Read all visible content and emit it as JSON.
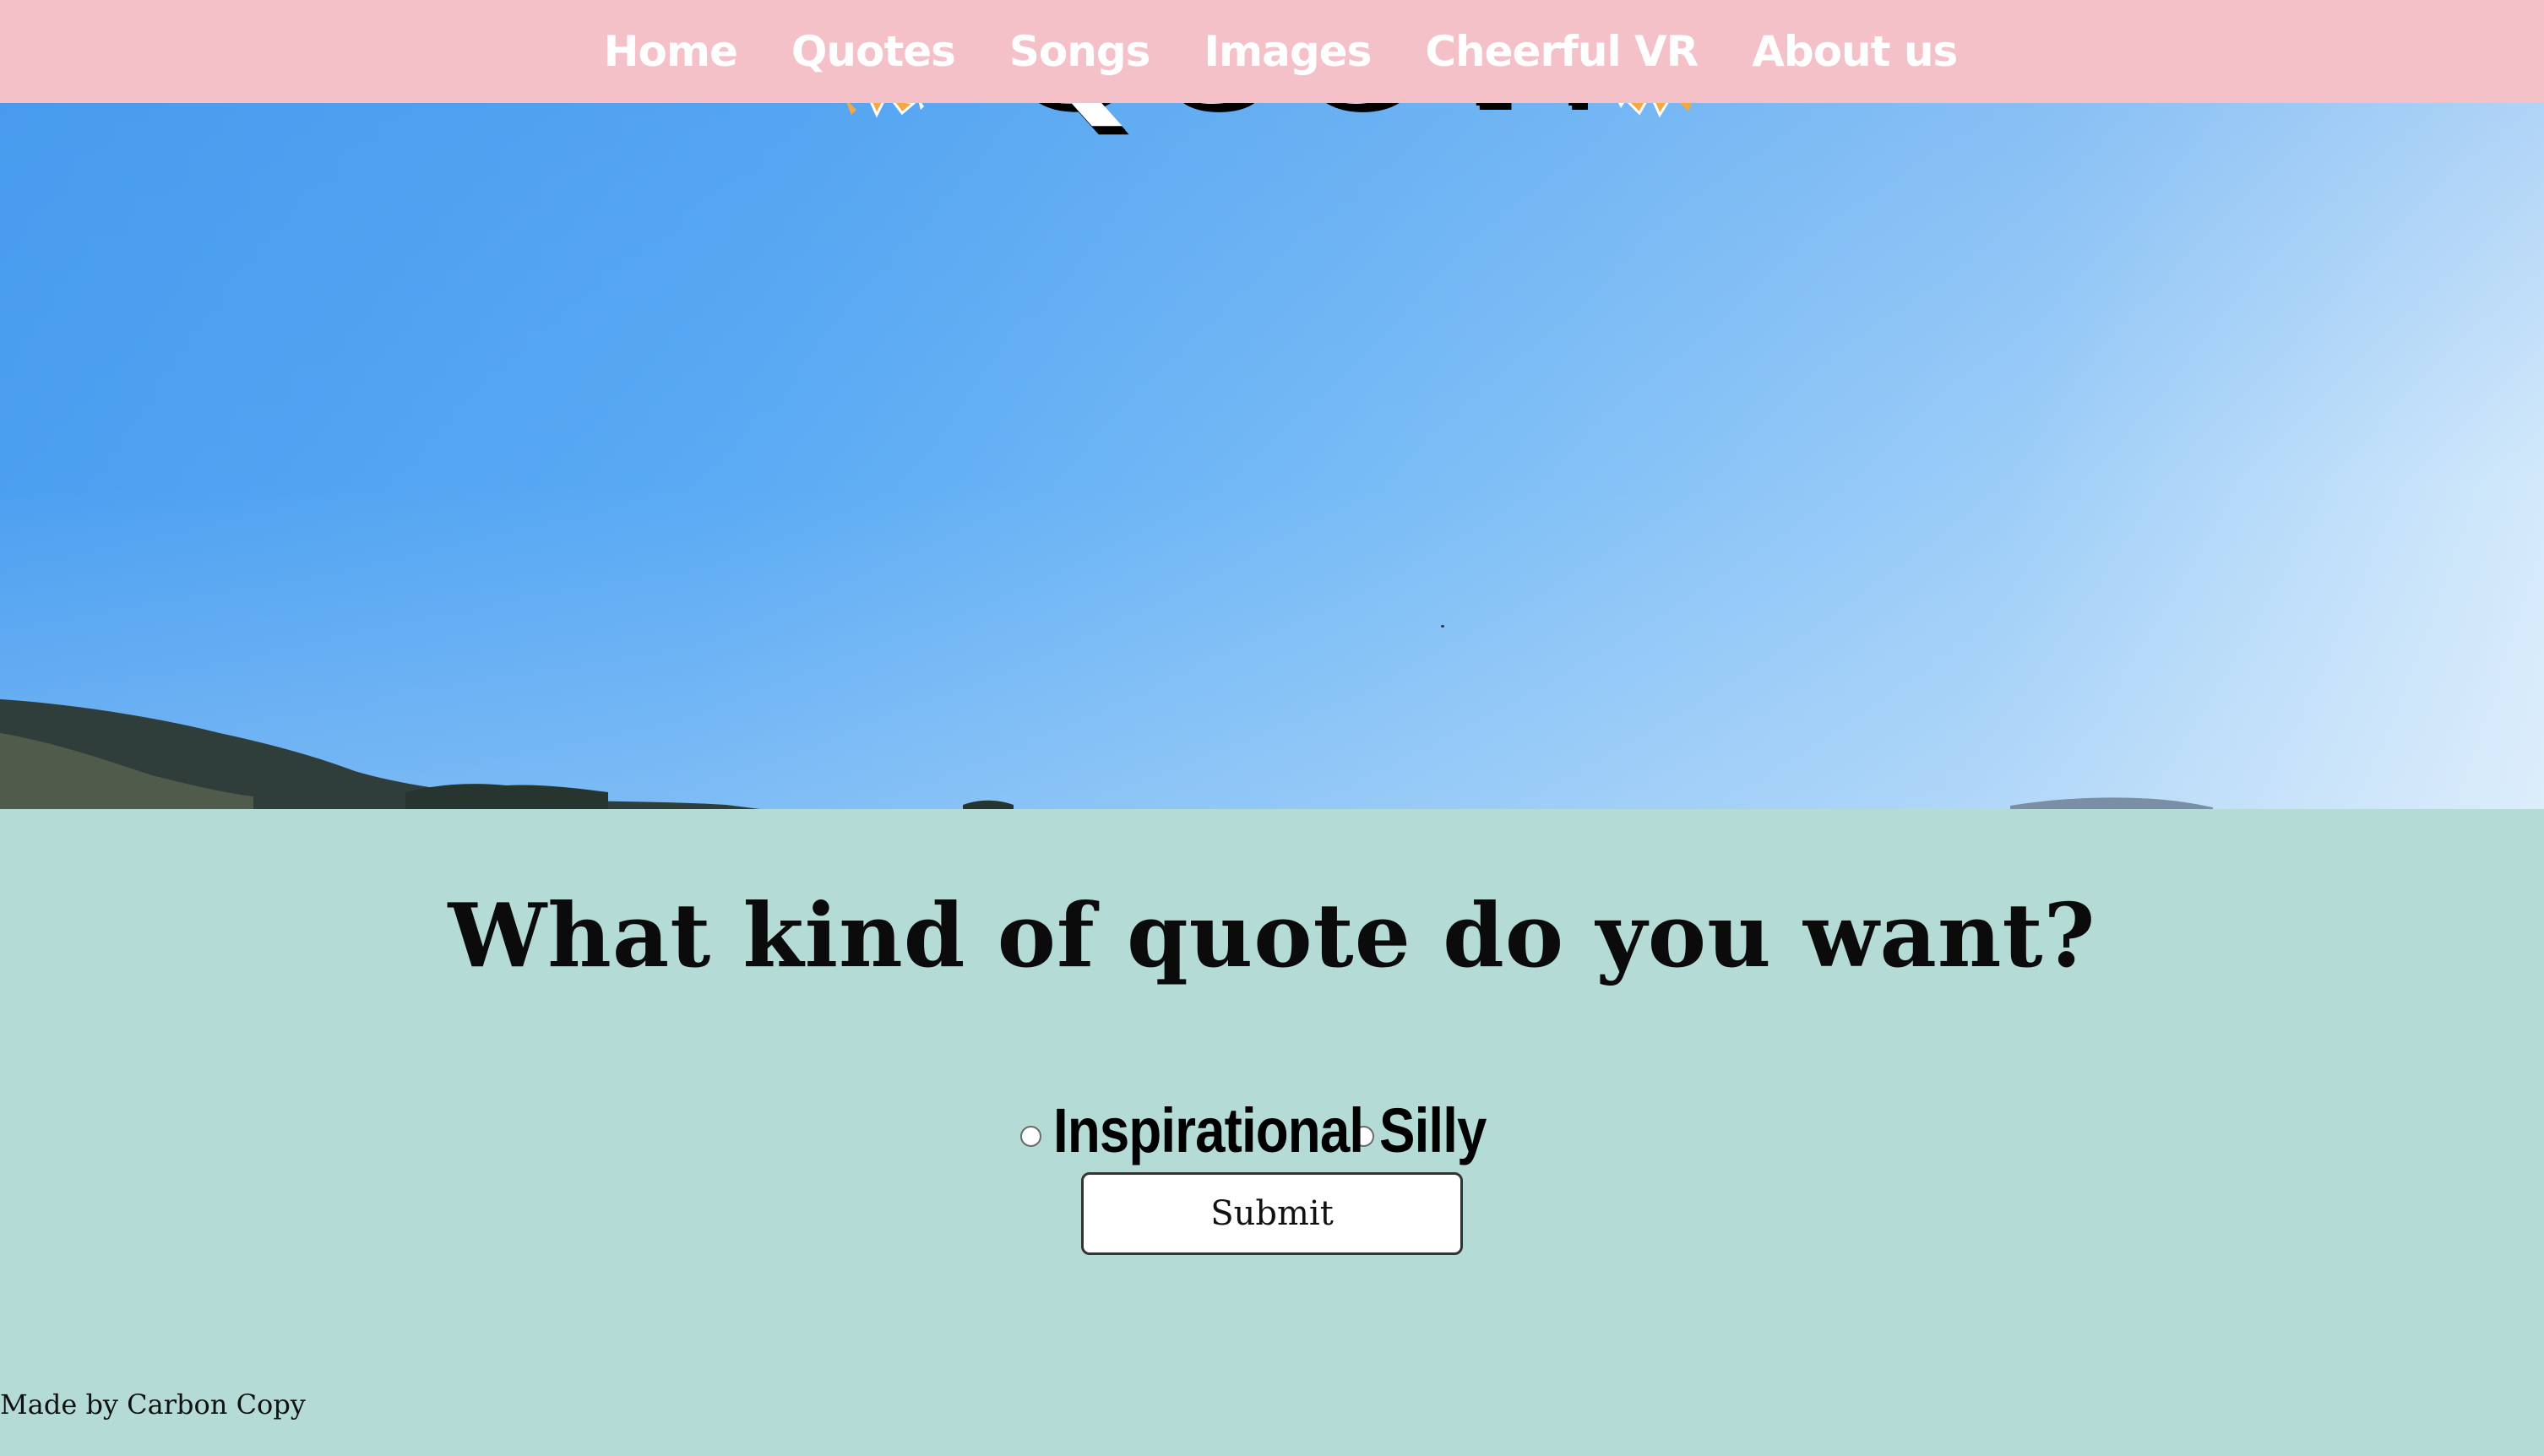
{
  "nav": {
    "items": [
      {
        "label": "Home"
      },
      {
        "label": "Quotes"
      },
      {
        "label": "Songs"
      },
      {
        "label": "Images"
      },
      {
        "label": "Cheerful VR"
      },
      {
        "label": "About us"
      }
    ]
  },
  "hero": {
    "title": "QUOTES"
  },
  "form": {
    "question": "What kind of quote do you want?",
    "options": [
      {
        "label": "Inspirational",
        "selected": false
      },
      {
        "label": "Silly",
        "selected": false
      }
    ],
    "submit_label": "Submit"
  },
  "footer": {
    "credit": "Made by Carbon Copy"
  },
  "colors": {
    "nav_background": "#f4c1c9",
    "content_background": "#b4dbd6",
    "sky_light": "#d9ecfb",
    "sky_dark": "#4a9ef0"
  }
}
